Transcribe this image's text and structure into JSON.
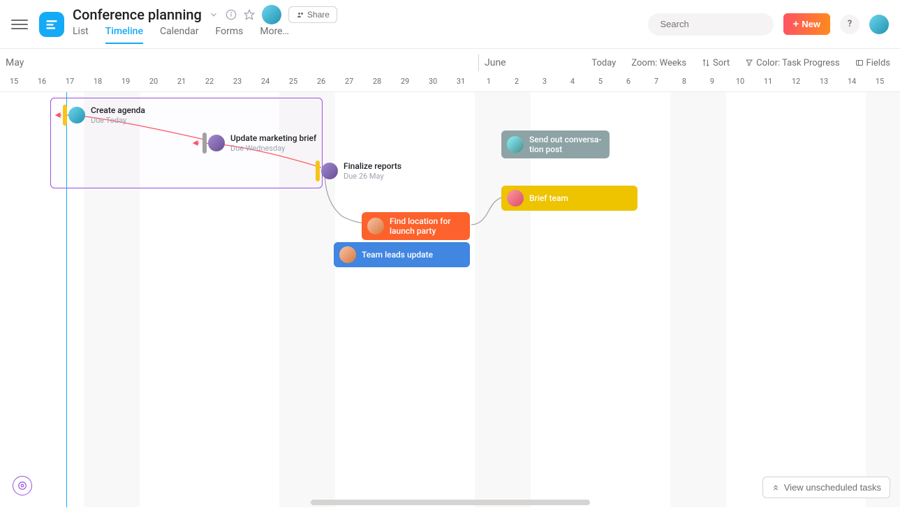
{
  "header": {
    "title": "Conference planning",
    "share_label": "Share",
    "tabs": [
      "List",
      "Timeline",
      "Calendar",
      "Forms",
      "More…"
    ],
    "active_tab": 1
  },
  "search": {
    "placeholder": "Search"
  },
  "new_button": "New",
  "toolbar": {
    "months": [
      "May",
      "June"
    ],
    "today": "Today",
    "zoom": "Zoom: Weeks",
    "sort": "Sort",
    "color": "Color: Task Progress",
    "fields": "Fields"
  },
  "dates": [
    "15",
    "16",
    "17",
    "18",
    "19",
    "20",
    "21",
    "22",
    "23",
    "24",
    "25",
    "26",
    "27",
    "28",
    "29",
    "30",
    "31",
    "1",
    "2",
    "3",
    "4",
    "5",
    "6",
    "7",
    "8",
    "9",
    "10",
    "11",
    "12",
    "13",
    "14",
    "15"
  ],
  "tasks": {
    "create_agenda": {
      "title": "Create agenda",
      "due": "Due Today"
    },
    "update_brief": {
      "title": "Update marketing brief",
      "due": "Due Wednesday"
    },
    "finalize_reports": {
      "title": "Finalize reports",
      "due": "Due 26 May"
    },
    "find_location": {
      "title": "Find location for launch party"
    },
    "team_leads": {
      "title": "Team leads update"
    },
    "send_out": {
      "title": "Send out conversa-\ntion post"
    },
    "brief_team": {
      "title": "Brief team"
    }
  },
  "unscheduled": "View unscheduled tasks",
  "colors": {
    "yellow": "#f5c518",
    "gray": "#a2a0a2",
    "orange": "#fd612c",
    "blue": "#4186e0",
    "slate": "#8da3a6",
    "gold": "#eec300"
  }
}
